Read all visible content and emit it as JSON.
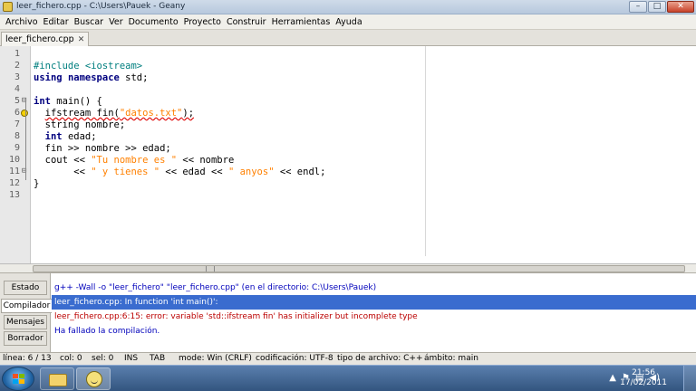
{
  "window": {
    "title": "leer_fichero.cpp - C:\\Users\\Pauek - Geany",
    "min_label": "–",
    "max_label": "□",
    "close_label": "✕"
  },
  "menu": [
    "Archivo",
    "Editar",
    "Buscar",
    "Ver",
    "Documento",
    "Proyecto",
    "Construir",
    "Herramientas",
    "Ayuda"
  ],
  "tab": {
    "label": "leer_fichero.cpp",
    "close": "✕"
  },
  "editor": {
    "line_numbers": [
      "1",
      "2",
      "3",
      "4",
      "5",
      "6",
      "7",
      "8",
      "9",
      "10",
      "11",
      "12",
      "13"
    ],
    "fold_markers": {
      "5": "⊟",
      "11": "⊟"
    },
    "lines": [
      [],
      [
        {
          "t": "#include <iostream>",
          "c": "pp"
        }
      ],
      [
        {
          "t": "using",
          "c": "kw"
        },
        {
          "t": " "
        },
        {
          "t": "namespace",
          "c": "kw"
        },
        {
          "t": " std;"
        }
      ],
      [],
      [
        {
          "t": "int",
          "c": "kw"
        },
        {
          "t": " main() {"
        }
      ],
      [
        {
          "t": "  "
        },
        {
          "t": "ifstream fin(",
          "c": "err"
        },
        {
          "t": "\"datos.txt\"",
          "c": "str err"
        },
        {
          "t": ");",
          "c": "err"
        }
      ],
      [
        {
          "t": "  string nombre;"
        }
      ],
      [
        {
          "t": "  "
        },
        {
          "t": "int",
          "c": "kw"
        },
        {
          "t": " edad;"
        }
      ],
      [
        {
          "t": "  fin >> nombre >> edad;"
        }
      ],
      [
        {
          "t": "  cout << "
        },
        {
          "t": "\"Tu nombre es \"",
          "c": "str"
        },
        {
          "t": " << nombre"
        }
      ],
      [
        {
          "t": "       << "
        },
        {
          "t": "\" y tienes \"",
          "c": "str"
        },
        {
          "t": " << edad << "
        },
        {
          "t": "\" anyos\"",
          "c": "str"
        },
        {
          "t": " << endl;"
        }
      ],
      [
        {
          "t": "}"
        }
      ],
      []
    ]
  },
  "messages": {
    "tabs": [
      "Estado",
      "Compilador",
      "Mensajes",
      "Borrador"
    ],
    "active_tab": "Compilador",
    "lines": [
      {
        "text": "g++ -Wall -o \"leer_fichero\" \"leer_fichero.cpp\" (en el directorio: C:\\Users\\Pauek)",
        "kind": "blue"
      },
      {
        "text": "leer_fichero.cpp: In function 'int main()':",
        "kind": "sel"
      },
      {
        "text": "leer_fichero.cpp:6:15: error: variable 'std::ifstream fin' has initializer but incomplete type",
        "kind": "red"
      },
      {
        "text": "Ha fallado la compilación.",
        "kind": "blue"
      }
    ]
  },
  "status": {
    "line": "línea: 6 / 13",
    "col": "col: 0",
    "sel": "sel: 0",
    "ins": "INS",
    "tab": "TAB",
    "mode": "mode: Win (CRLF)",
    "encoding": "codificación: UTF-8",
    "filetype": "tipo de archivo: C++",
    "scope": "ámbito: main"
  },
  "taskbar": {
    "time": "21:56",
    "date": "17/02/2011"
  },
  "icons": [
    "geany-app-icon",
    "minimize-icon",
    "maximize-icon",
    "close-icon",
    "tab-close-icon",
    "fold-icon",
    "warning-marker-icon",
    "windows-start-icon",
    "explorer-folder-icon",
    "geany-taskbar-icon",
    "tray-chevron-icon",
    "flag-icon",
    "network-icon",
    "volume-icon"
  ]
}
